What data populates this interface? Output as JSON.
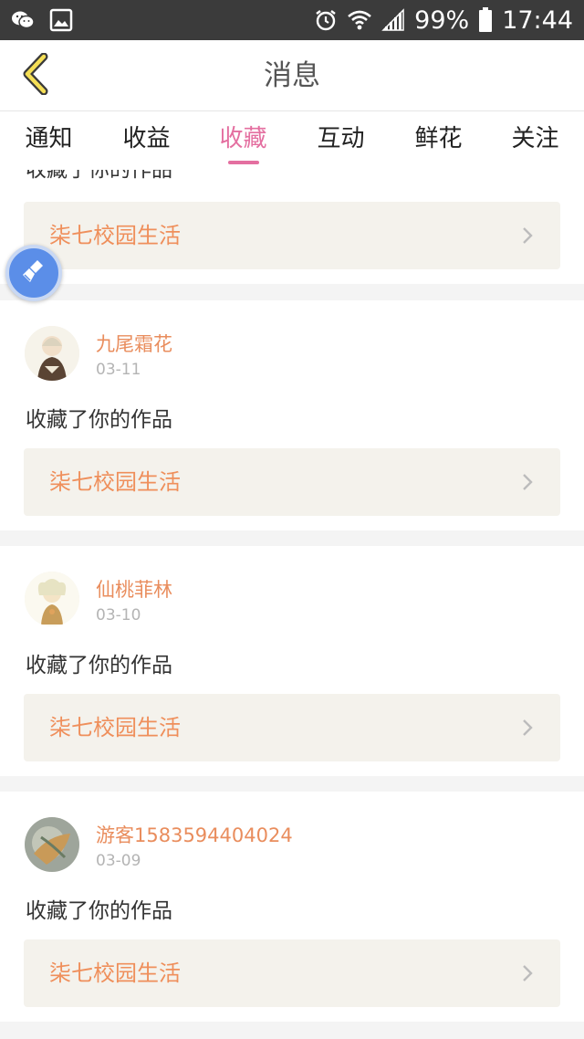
{
  "status_bar": {
    "battery": "99%",
    "time": "17:44"
  },
  "header": {
    "title": "消息"
  },
  "tabs": [
    {
      "label": "通知"
    },
    {
      "label": "收益"
    },
    {
      "label": "收藏",
      "active": true
    },
    {
      "label": "互动"
    },
    {
      "label": "鲜花"
    },
    {
      "label": "关注"
    }
  ],
  "partial_item": {
    "action": "收藏了你的作品",
    "work_title": "柒七校园生活"
  },
  "items": [
    {
      "username": "九尾霜花",
      "date": "03-11",
      "action": "收藏了你的作品",
      "work_title": "柒七校园生活"
    },
    {
      "username": "仙桃菲林",
      "date": "03-10",
      "action": "收藏了你的作品",
      "work_title": "柒七校园生活"
    },
    {
      "username": "游客1583594404024",
      "date": "03-09",
      "action": "收藏了你的作品",
      "work_title": "柒七校园生活"
    }
  ],
  "colors": {
    "accent": "#e46fa0",
    "username": "#e98d5d",
    "work_title": "#ef8f5b",
    "status_bar": "#3b3b3b"
  }
}
